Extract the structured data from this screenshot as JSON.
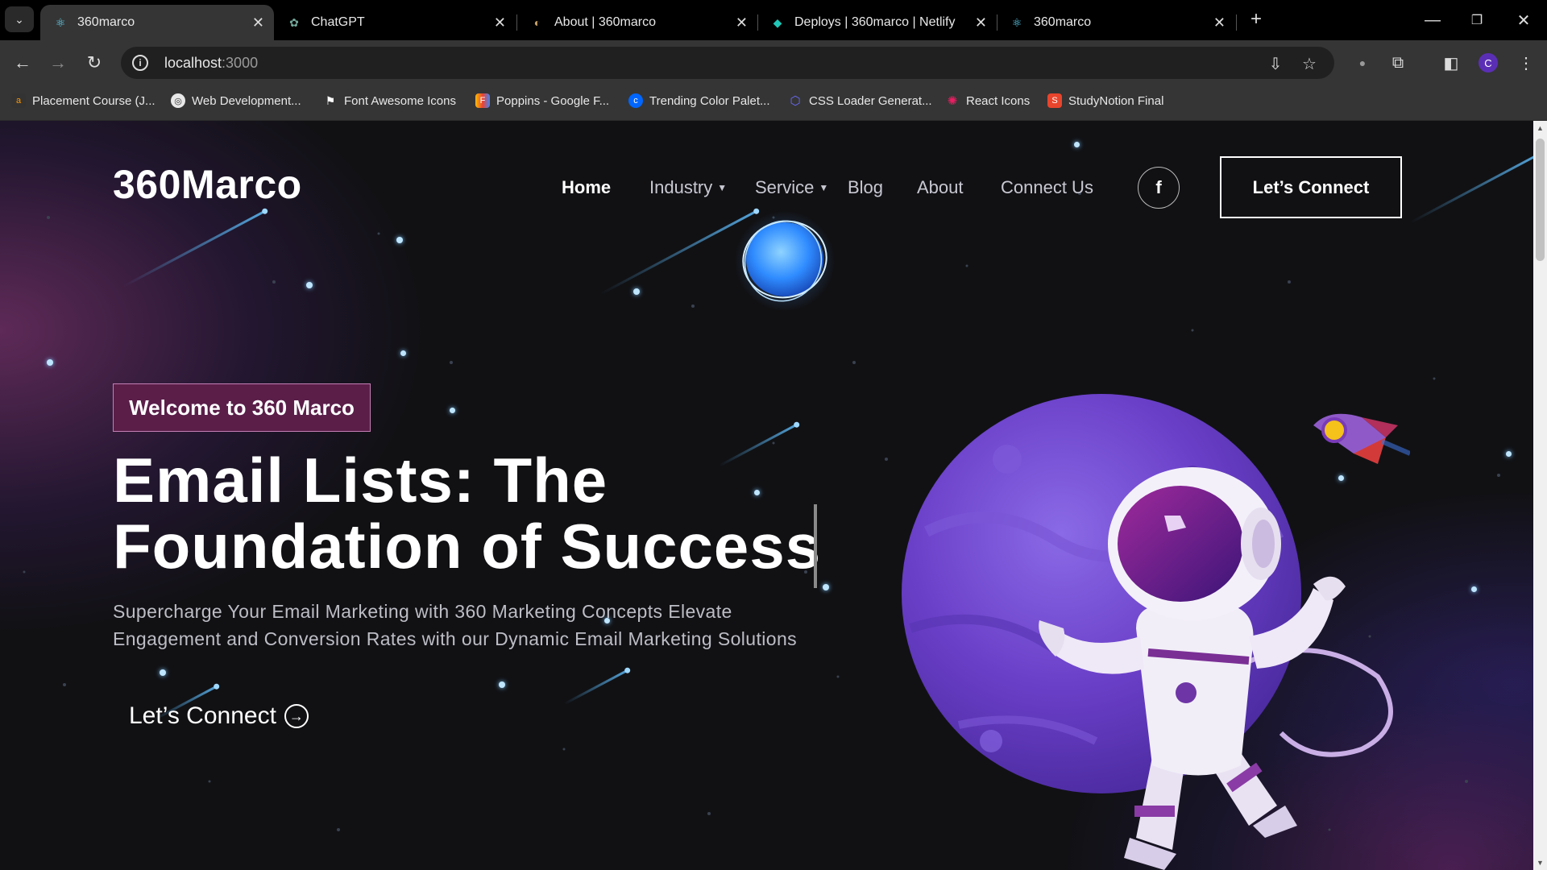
{
  "browser": {
    "tabs": [
      {
        "title": "360marco",
        "active": true,
        "icon": "react-icon"
      },
      {
        "title": "ChatGPT",
        "active": false,
        "icon": "chatgpt-icon"
      },
      {
        "title": "About | 360marco",
        "active": false,
        "icon": "site-icon"
      },
      {
        "title": "Deploys | 360marco | Netlify",
        "active": false,
        "icon": "netlify-icon"
      },
      {
        "title": "360marco",
        "active": false,
        "icon": "react-icon"
      }
    ],
    "url_host": "localhost",
    "url_port": ":3000",
    "profile_initial": "C",
    "bookmarks": [
      {
        "label": "Placement Course (J..."
      },
      {
        "label": "Web Development..."
      },
      {
        "label": "Font Awesome Icons"
      },
      {
        "label": "Poppins - Google F..."
      },
      {
        "label": "Trending Color Palet..."
      },
      {
        "label": "CSS Loader Generat..."
      },
      {
        "label": "React Icons"
      },
      {
        "label": "StudyNotion Final"
      }
    ]
  },
  "site": {
    "logo": "360Marco",
    "nav": {
      "home": "Home",
      "industry": "Industry",
      "service": "Service",
      "blog": "Blog",
      "about": "About",
      "connect": "Connect Us"
    },
    "facebook_glyph": "f",
    "cta_top": "Let’s Connect",
    "badge": "Welcome to 360 Marco",
    "headline_line1": "Email Lists: The",
    "headline_line2": "Foundation of Success",
    "subtext": "Supercharge Your Email Marketing with 360 Marketing Concepts Elevate Engagement and Conversion Rates with our Dynamic Email Marketing Solutions",
    "cta_bottom": "Let’s Connect",
    "colors": {
      "badge_bg": "#5a1e49",
      "planet": "#6a3fc8",
      "accent_glow": "#4fb3ff"
    },
    "illustrations": [
      "astronaut-illustration",
      "planet-illustration",
      "rocket-illustration",
      "glowing-orb-illustration"
    ]
  }
}
